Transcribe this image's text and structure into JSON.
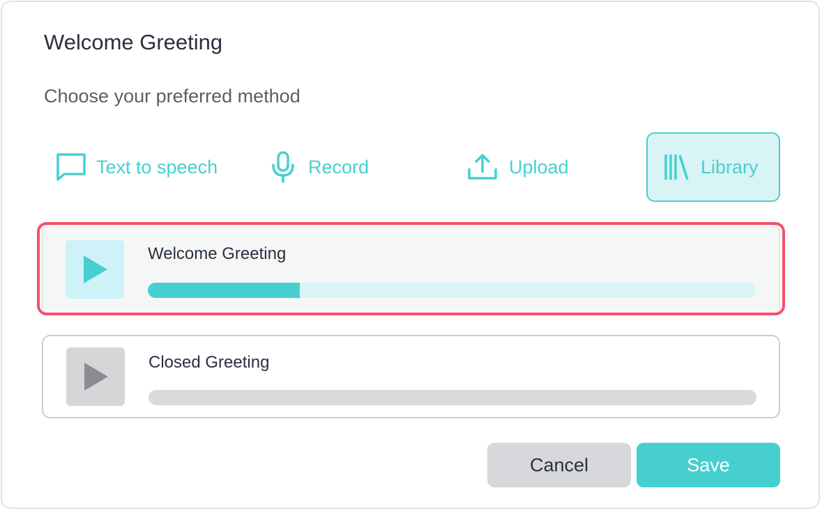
{
  "dialog": {
    "title": "Welcome Greeting",
    "subtitle": "Choose your preferred method"
  },
  "methods": [
    {
      "label": "Text to speech",
      "icon": "speech-bubble-icon",
      "selected": false
    },
    {
      "label": "Record",
      "icon": "microphone-icon",
      "selected": false
    },
    {
      "label": "Upload",
      "icon": "upload-icon",
      "selected": false
    },
    {
      "label": "Library",
      "icon": "library-icon",
      "selected": true
    }
  ],
  "tracks": [
    {
      "name": "Welcome Greeting",
      "icon": "play-icon",
      "progress": 0.25,
      "highlighted": true
    },
    {
      "name": "Closed Greeting",
      "icon": "play-icon",
      "progress": 0,
      "highlighted": false
    }
  ],
  "buttons": {
    "cancel": "Cancel",
    "save": "Save"
  },
  "colors": {
    "accent": "#47cfcf",
    "highlight": "#f4506c",
    "text": "#2c2f3d",
    "muted": "#5a5e68",
    "disabled_play": "#8a8c92"
  }
}
